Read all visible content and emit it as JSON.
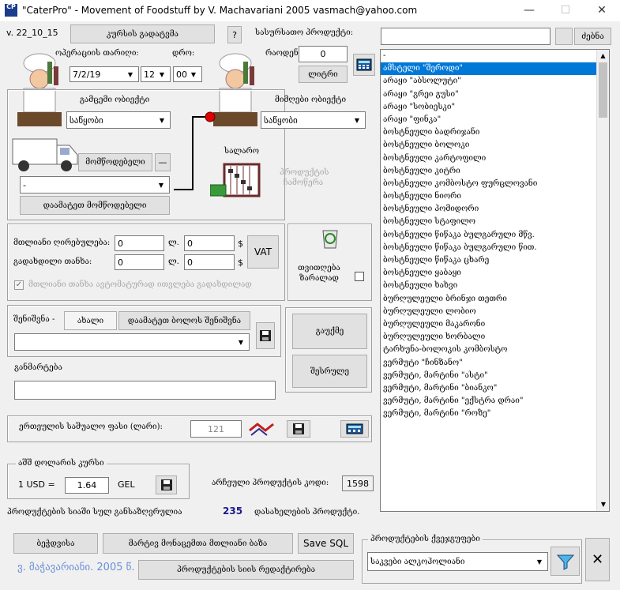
{
  "window": {
    "title": "\"CaterPro\" - Movement of Foodstuff by V. Machavariani  2005 vasmach@yahoo.com",
    "icon_text": "CP",
    "minimize": "—",
    "maximize": "☐",
    "close": "✕"
  },
  "header": {
    "version": "v. 22_10_15",
    "back_button": "კურსის გადატვმა",
    "help_button": "?",
    "product_name_label": "სასურსათო პროდუქტი:",
    "quantity_label": "რაოდენობა:",
    "quantity_value": "0",
    "unit_button": "ლიტრი",
    "search_button": "ძებნა"
  },
  "operation": {
    "date_label": "ოპერაციის თარიღი:",
    "time_label": "დრო:",
    "date_value": "7/2/19",
    "hour_value": "12",
    "minute_value": "00"
  },
  "source": {
    "label": "გამცემი ობიექტი",
    "value": "საწყობი",
    "transport_button": "მომწოდებელი",
    "minus_button": "—",
    "supplier_value": "-",
    "add_supplier_button": "დაამატეთ მომწოდებელი"
  },
  "target": {
    "label": "მიმღები ობიექტი",
    "value": "საწყობი"
  },
  "abacus_label": "სალარო",
  "product_transfer_label": "პროდუქტის ჩამოწერა",
  "trash_label": "თვითღება ზარალად",
  "totals": {
    "total_price_label": "მთლიანი ღირებულება:",
    "tax_label": "გადახდილი თანხა:",
    "total_lari": "0",
    "total_tetri": "0",
    "tax_lari": "0",
    "tax_tetri": "0",
    "currency_gel": "ლ.",
    "currency_usd": "$",
    "vat_button": "VAT",
    "auto_checkbox_label": "მთლიანი თანხა ავტომატურად ითვლება გადახდილად"
  },
  "note": {
    "label": "შენიშვნა -",
    "new_button": "ახალი",
    "add_button": "დაამატეთ ბოლოს შენიშვნა",
    "value": ""
  },
  "actions": {
    "cancel_button": "გაუქმე",
    "execute_button": "შესრულე"
  },
  "comment": {
    "label": "განმარტება",
    "value": ""
  },
  "unit_price": {
    "label": "ერთეულის საშუალო ფასი (ლარი):",
    "value": "121"
  },
  "exchange": {
    "title": "აშშ დოლარის კურსი",
    "usd_label": "1 USD =",
    "rate_value": "1.64",
    "currency": "GEL"
  },
  "product_code": {
    "label": "არჩეული პროდუქტის კოდი:",
    "value": "1598"
  },
  "product_count": {
    "label_left": "პროდუქტების სიაში სულ განსაზღვრულია",
    "count": "235",
    "label_right": "დასახელების პროდუქტი."
  },
  "bottom_buttons": {
    "print_button": "ბეჭდვისა",
    "db_button": "მარტივ მონაცემთა მთლიანი ბაზა",
    "save_sql_button": "Save SQL",
    "product_list_button": "პროდუქტების სიის რედაქტირება",
    "copyright": "ვ. მაჭავარიანი. 2005 წ."
  },
  "category": {
    "title": "პროდუქტების ქვეჯგუფები",
    "value": "საკვები ალკოჰოლიანი"
  },
  "product_list": {
    "items": [
      "-",
      "ამსტელი \"შეროდი\"",
      "არაყი \"აბსოლუტი\"",
      "არაყი \"გრეი გუსი\"",
      "არაყი \"სობიესკი\"",
      "არაყი \"ფინკა\"",
      "ბოსტნეული ბადრიჯანი",
      "ბოსტნეული ბოლოკი",
      "ბოსტნეული კარტოფილი",
      "ბოსტნეული კიტრი",
      "ბოსტნეული კომბოსტო ფურცლოვანი",
      "ბოსტნეული ნიორი",
      "ბოსტნეული პომიდორი",
      "ბოსტნეული სტაფილო",
      "ბოსტნეული წიწაკა ბულგარული მწვ.",
      "ბოსტნეული წიწაკა ბულგარული წით.",
      "ბოსტნეული წიწაკა ცხარე",
      "ბოსტნეული ყაბაყი",
      "ბოსტნეული ხახვი",
      "ბურღულეული ბრინჯი თეთრი",
      "ბურღულეული ლობიო",
      "ბურღულეული მაკარონი",
      "ბურღულეული ხორბალი",
      "ტარხუნა-ბოლოკის კომბოსტო",
      "ვერმუტი \"ჩინზანო\"",
      "ვერმუტი, მარტინი \"ასტი\"",
      "ვერმუტი, მარტინი \"ბიანკო\"",
      "ვერმუტი, მარტინი \"ექსტრა დრაი\"",
      "ვერმუტი, მარტინი \"როზე\""
    ],
    "selected_index": 1
  },
  "colors": {
    "selection": "#0078d7",
    "count": "#1a1a8c",
    "copyright": "#6a8fd8",
    "connector": "#000000",
    "dot": "#e00000"
  }
}
